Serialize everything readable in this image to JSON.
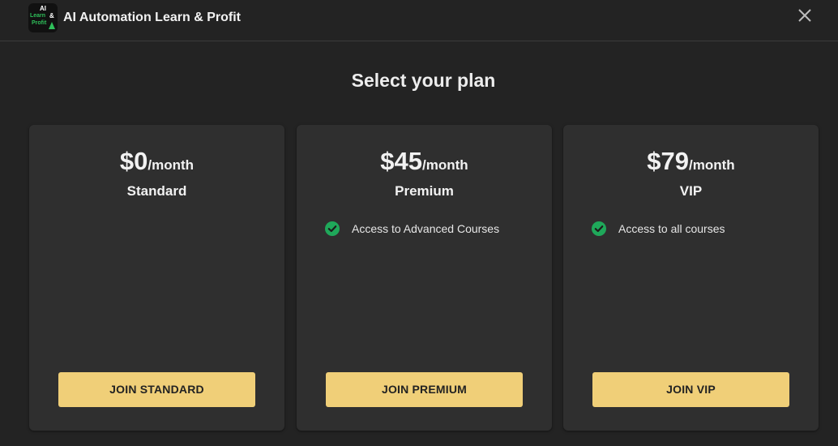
{
  "header": {
    "logo_text": {
      "line1": "AI",
      "line2": "Learn",
      "amp": "&",
      "line3": "Profit"
    },
    "title": "AI Automation Learn & Profit",
    "close_icon": "close-icon"
  },
  "page_title": "Select your plan",
  "plans": [
    {
      "price": "$0",
      "period": "/month",
      "name": "Standard",
      "features": [],
      "button_label": "JOIN STANDARD"
    },
    {
      "price": "$45",
      "period": "/month",
      "name": "Premium",
      "features": [
        "Access to Advanced Courses"
      ],
      "button_label": "JOIN PREMIUM"
    },
    {
      "price": "$79",
      "period": "/month",
      "name": "VIP",
      "features": [
        "Access to all courses"
      ],
      "button_label": "JOIN VIP"
    }
  ],
  "colors": {
    "background": "#232323",
    "card": "#2f2f2f",
    "button": "#f0cf78",
    "check": "#1fa85a"
  }
}
